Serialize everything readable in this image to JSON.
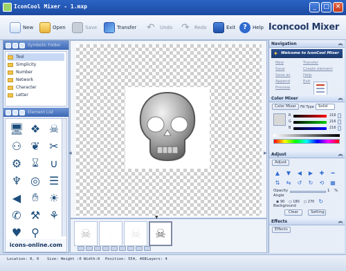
{
  "window": {
    "title": "IconCool Mixer - 1.mxp",
    "minimize": "_",
    "maximize": "□",
    "close": "✕"
  },
  "toolbar": {
    "new": "New",
    "open": "Open",
    "save": "Save",
    "transfer": "Transfer",
    "undo": "Undo",
    "redo": "Redo",
    "exit": "Exit",
    "help": "Help",
    "brand": "Iconcool Mixer"
  },
  "left_panel": {
    "folder_header": "Symbolic Folder",
    "folders": [
      "Tool",
      "Simplicity",
      "Number",
      "Network",
      "Character",
      "Letter"
    ],
    "selected_folder": 0,
    "gallery_header": "Element List",
    "gallery_footer": "icons-online.com",
    "gallery_icons": [
      "monitor-icon",
      "dropbox-icon",
      "skull-icon",
      "people-icon",
      "leaf-icon",
      "scissors-icon",
      "gear-icon",
      "hourglass-icon",
      "magnet-icon",
      "glass-icon",
      "disc-icon",
      "layers-icon",
      "speaker-icon",
      "handshake-icon",
      "sun-icon",
      "phone-icon",
      "wrench-icon",
      "ribbon-icon",
      "heart-pin-icon",
      "magnifier-icon"
    ]
  },
  "right_panel": {
    "navigation": {
      "title": "Navigation",
      "welcome": "Welcome to IconCool Mixer",
      "links": [
        "New",
        "Transfer",
        "Save",
        "Create element",
        "Save as",
        "Help",
        "Append",
        "Exit",
        "Preview"
      ]
    },
    "color_mixer": {
      "title": "Color Mixer",
      "tab": "Color Mixer",
      "fill_type_label": "Fill Type",
      "fill_type_value": "Solid",
      "r_label": "R",
      "r_value": "216",
      "g_label": "G",
      "g_value": "216",
      "b_label": "B",
      "b_value": "216"
    },
    "adjust": {
      "title": "Adjust",
      "tab": "Adjust",
      "opacity_label": "Opacity",
      "opacity_value": "1",
      "opacity_unit": "%",
      "angle_label": "Angle",
      "angles": [
        "90",
        "180",
        "270"
      ],
      "background_label": "Background",
      "clear": "Clear",
      "setting": "Setting"
    },
    "effects": {
      "title": "Effects",
      "tab": "Effects"
    }
  },
  "status_bar": {
    "location": "Location: 0, 0",
    "size": "Size: Height :0   Width:0",
    "position": "Position: 554, 468",
    "layers": "Layers: 4"
  }
}
